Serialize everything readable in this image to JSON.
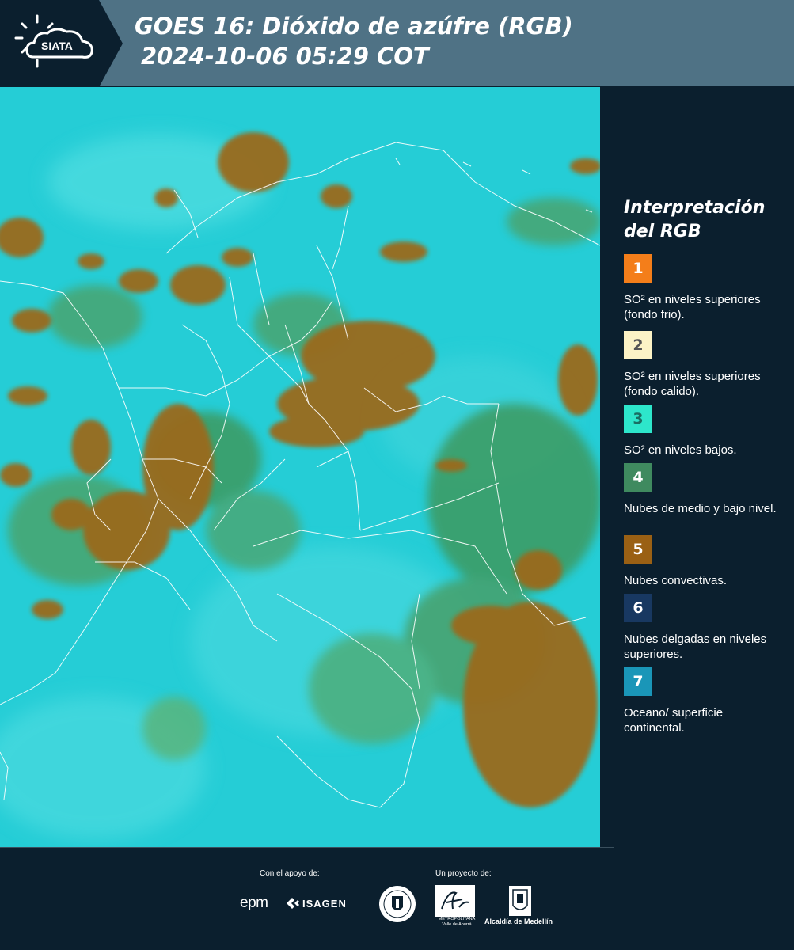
{
  "header": {
    "logo_text": "SIATA",
    "title_line1": "GOES 16: Dióxido de azúfre (RGB)",
    "title_line2": "2024-10-06 05:29 COT"
  },
  "legend": {
    "title_line1": "Interpretación",
    "title_line2": "del RGB",
    "items": [
      {
        "number": "1",
        "label": "SO² en niveles superiores (fondo frio).",
        "color": "#f47e1a",
        "text_color": "#ffffff"
      },
      {
        "number": "2",
        "label": "SO² en niveles superiores (fondo calido).",
        "color": "#fcf3c6",
        "text_color": "#555555"
      },
      {
        "number": "3",
        "label": "SO² en niveles bajos.",
        "color": "#2de6cb",
        "text_color": "#1a6e63"
      },
      {
        "number": "4",
        "label": "Nubes de medio y bajo nivel.",
        "color": "#3f8a5f",
        "text_color": "#ffffff"
      },
      {
        "number": "5",
        "label": "Nubes convectivas.",
        "color": "#9a6014",
        "text_color": "#ffffff"
      },
      {
        "number": "6",
        "label": "Nubes delgadas en niveles superiores.",
        "color": "#183861",
        "text_color": "#ffffff"
      },
      {
        "number": "7",
        "label": "Oceano/ superficie continental.",
        "color": "#1a96b8",
        "text_color": "#ffffff"
      }
    ]
  },
  "footer": {
    "support_label": "Con el apoyo de:",
    "project_label": "Un proyecto de:",
    "sponsor_epm": "epm",
    "sponsor_isagen": "ISAGEN",
    "area_text": "METROPOLITANA Valle de Aburrá",
    "alcaldia_text": "Alcaldía de Medellín"
  },
  "colors": {
    "background": "#0b1f2e",
    "header_band": "#4f7285",
    "map_base": "#25cdd6",
    "convective": "#9a6a1e",
    "mid_cloud": "#3c9a60"
  }
}
